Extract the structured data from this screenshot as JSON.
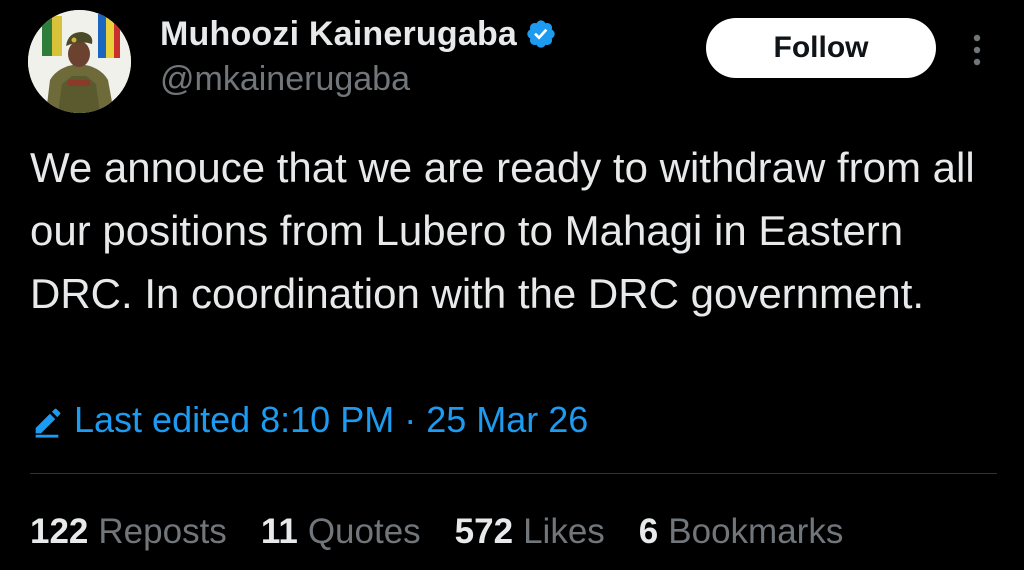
{
  "author": {
    "display_name": "Muhoozi Kainerugaba",
    "handle": "@mkainerugaba",
    "verified_icon": "verified-badge-icon",
    "avatar": "avatar-photo"
  },
  "actions": {
    "follow_label": "Follow",
    "more_icon": "more-vertical-icon"
  },
  "tweet": {
    "text": "We annouce that we are ready to withdraw from all our positions from Lubero to Mahagi in Eastern DRC. In coordination with the DRC government.",
    "edited_label": "Last edited 8:10 PM · 25 Mar 26",
    "edited_icon": "edit-pencil-icon"
  },
  "stats": {
    "reposts": {
      "count": "122",
      "label": "Reposts"
    },
    "quotes": {
      "count": "11",
      "label": "Quotes"
    },
    "likes": {
      "count": "572",
      "label": "Likes"
    },
    "bookmarks": {
      "count": "6",
      "label": "Bookmarks"
    }
  },
  "colors": {
    "background": "#000000",
    "text_primary": "#e7e9ea",
    "text_secondary": "#71767b",
    "accent": "#1d9bf0",
    "divider": "#2f3336",
    "button_bg": "#ffffff"
  }
}
